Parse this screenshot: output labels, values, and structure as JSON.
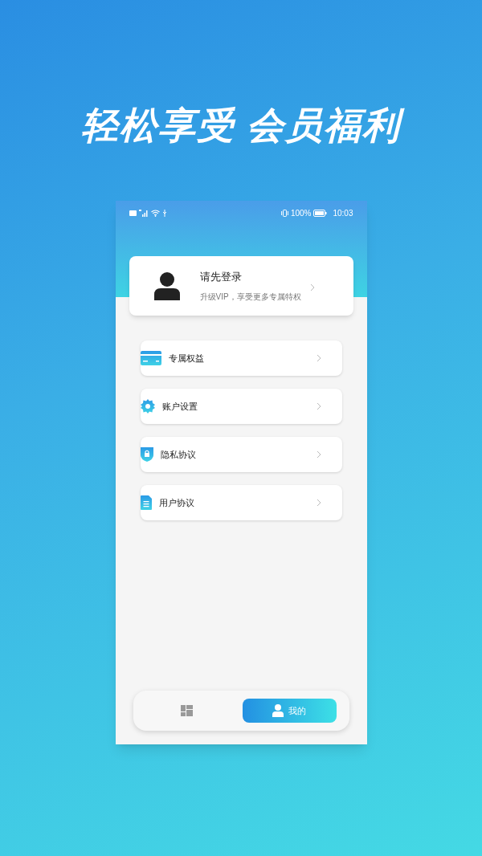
{
  "headline": "轻松享受 会员福利",
  "status_bar": {
    "battery": "100%",
    "time": "10:03"
  },
  "profile": {
    "title": "请先登录",
    "subtitle": "升级VIP，享受更多专属特权"
  },
  "menu": [
    {
      "kind": "card",
      "label": "专属权益"
    },
    {
      "kind": "gear",
      "label": "账户设置"
    },
    {
      "kind": "shield",
      "label": "隐私协议"
    },
    {
      "kind": "document",
      "label": "用户协议"
    }
  ],
  "tabs": [
    {
      "kind": "grid",
      "selected": false
    },
    {
      "kind": "person",
      "label": "我的",
      "selected": true
    }
  ]
}
